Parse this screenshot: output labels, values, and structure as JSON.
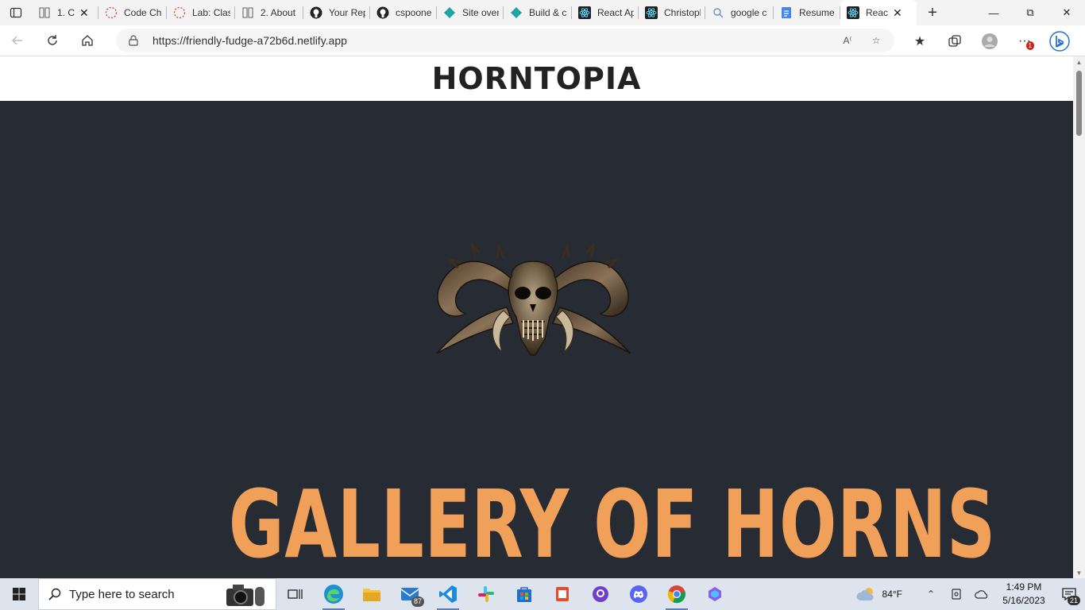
{
  "browser": {
    "tabs": [
      {
        "title": "1. C",
        "icon": "reader-icon"
      },
      {
        "title": "Code Ch",
        "icon": "dotted-circle-icon"
      },
      {
        "title": "Lab: Clas",
        "icon": "dotted-circle-icon"
      },
      {
        "title": "2. About",
        "icon": "reader-icon"
      },
      {
        "title": "Your Rep",
        "icon": "github-icon"
      },
      {
        "title": "cspoone",
        "icon": "github-icon"
      },
      {
        "title": "Site over",
        "icon": "netlify-icon"
      },
      {
        "title": "Build & c",
        "icon": "netlify-icon"
      },
      {
        "title": "React Ap",
        "icon": "react-icon"
      },
      {
        "title": "Christopl",
        "icon": "react-icon"
      },
      {
        "title": "google c",
        "icon": "search-icon"
      },
      {
        "title": "Resume",
        "icon": "docs-icon"
      },
      {
        "title": "Reac",
        "icon": "react-icon",
        "active": true
      }
    ],
    "url": "https://friendly-fudge-a72b6d.netlify.app",
    "profile_notification": "1"
  },
  "page": {
    "site_title": "HORNTOPIA",
    "gallery_title": "GALLERY OF HORNS",
    "colors": {
      "header_bg": "#ffffff",
      "hero_bg": "#272b33",
      "accent": "#f1a05a"
    }
  },
  "taskbar": {
    "search_placeholder": "Type here to search",
    "mail_badge": "87",
    "weather": "84°F",
    "time": "1:49 PM",
    "date": "5/16/2023",
    "notifications": "21"
  }
}
